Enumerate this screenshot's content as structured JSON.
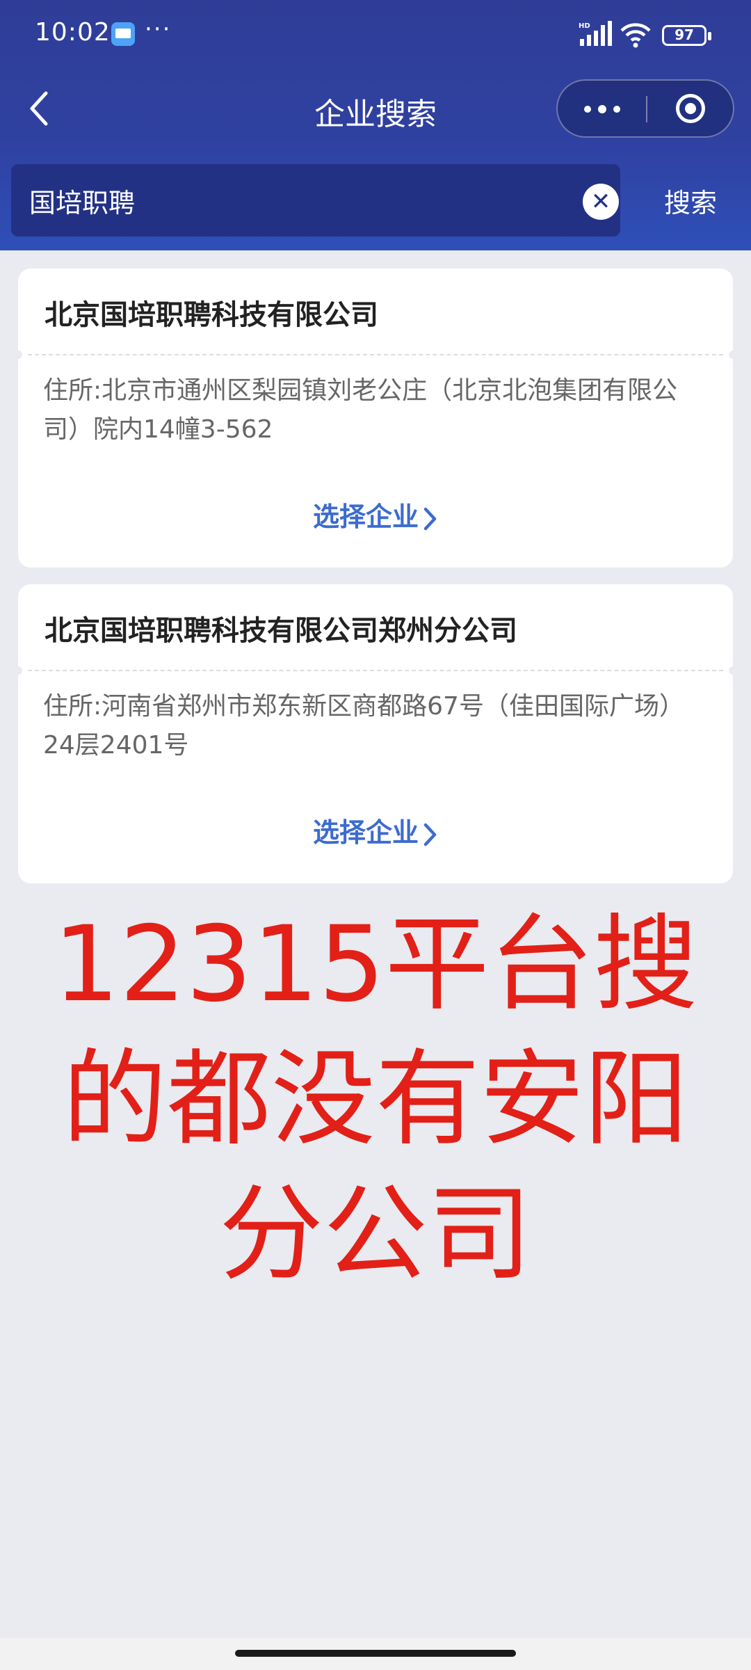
{
  "status_bar": {
    "time": "10:02",
    "battery": "97"
  },
  "nav": {
    "title": "企业搜索"
  },
  "search": {
    "value": "国培职聘",
    "clear_symbol": "✕",
    "button_label": "搜索"
  },
  "results": [
    {
      "name": "北京国培职聘科技有限公司",
      "address": "住所:北京市通州区梨园镇刘老公庄（北京北泡集团有限公司）院内14幢3-562",
      "action": "选择企业"
    },
    {
      "name": "北京国培职聘科技有限公司郑州分公司",
      "address": "住所:河南省郑州市郑东新区商都路67号（佳田国际广场）24层2401号",
      "action": "选择企业"
    }
  ],
  "overlay": {
    "lines": [
      "12315平台搜",
      "的都没有安阳",
      "分公司"
    ]
  },
  "colors": {
    "header": "#2f3d97",
    "search_box": "#233185",
    "link": "#3c6bd0",
    "overlay_text": "#e22018",
    "background": "#e9ebf0"
  }
}
